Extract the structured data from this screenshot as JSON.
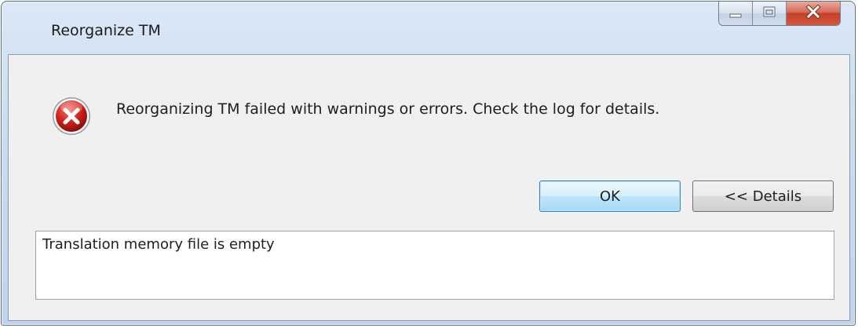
{
  "window": {
    "title": "Reorganize TM"
  },
  "caption_buttons": {
    "minimize_icon": "minimize-icon",
    "maximize_icon": "maximize-icon",
    "close_icon": "close-icon"
  },
  "message": {
    "icon": "error-icon",
    "text": "Reorganizing TM failed with warnings or errors. Check the log for details."
  },
  "buttons": {
    "ok_label": "OK",
    "details_label": "<< Details"
  },
  "details": {
    "text": "Translation memory file is empty"
  },
  "colors": {
    "error_red": "#c8141e",
    "titlebar": "#c9dcf0",
    "close_button": "#c4402a",
    "default_button_border": "#3c7fb1"
  }
}
